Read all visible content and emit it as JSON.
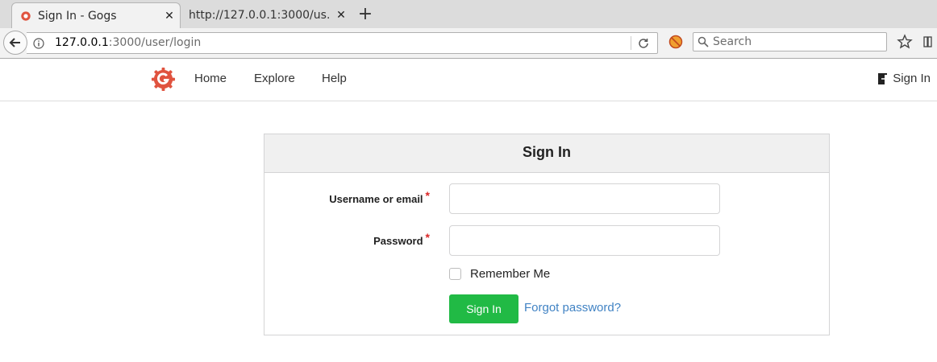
{
  "browser": {
    "tabs": [
      {
        "title": "Sign In - Gogs",
        "active": true
      },
      {
        "title": "http://127.0.0.1:3000/us…",
        "active": false
      }
    ],
    "url_host": "127.0.0.1",
    "url_path": ":3000/user/login",
    "search_placeholder": "Search"
  },
  "header": {
    "nav": [
      "Home",
      "Explore",
      "Help"
    ],
    "signin_label": "Sign In",
    "logo_color": "#e0533f"
  },
  "login": {
    "heading": "Sign In",
    "username_label": "Username or email",
    "password_label": "Password",
    "required_mark": "*",
    "remember_label": "Remember Me",
    "submit_label": "Sign In",
    "forgot_label": "Forgot password?",
    "submit_color": "#21ba45",
    "link_color": "#4183c4"
  }
}
